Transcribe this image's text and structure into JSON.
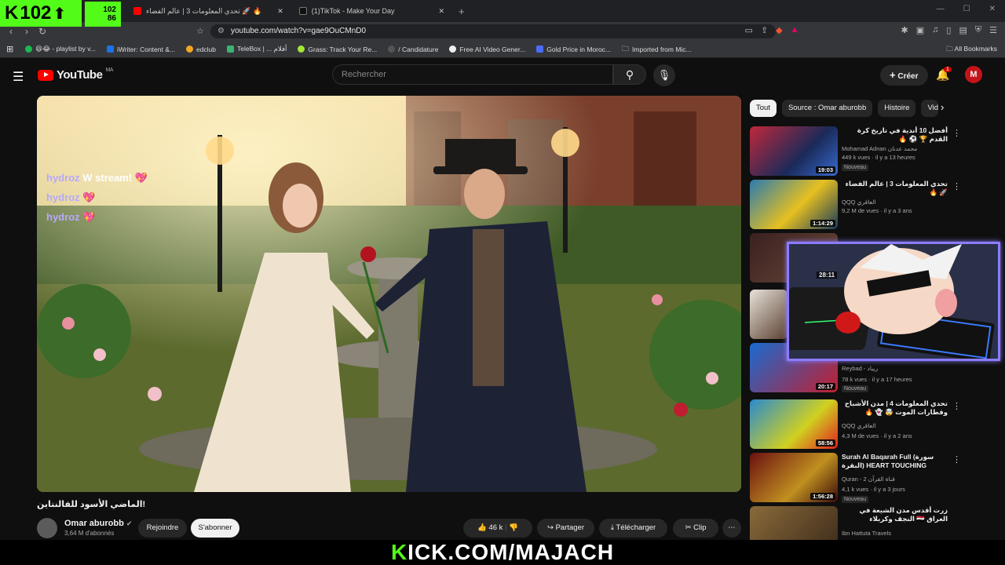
{
  "kick": {
    "viewers": "102",
    "small_top": "102",
    "small_bottom": "86",
    "footer_k": "K",
    "footer_rest": "ICK.COM/MAJACH"
  },
  "browser": {
    "tabs": [
      {
        "title": "تحدي المعلومات 3 | عالم الفضاء 🚀 🔥",
        "active": false
      },
      {
        "title": "(1)TikTok - Make Your Day",
        "active": false
      }
    ],
    "url": "youtube.com/watch?v=gae9OuCMnD0",
    "bookmarks": [
      "😆😂 - playlist by v...",
      "iWriter: Content &...",
      "edclub",
      "TeleBox | ... أفلام",
      "Grass: Track Your Re...",
      "/ Candidature",
      "Free AI Video Gener...",
      "Gold Price in Moroc...",
      "Imported from Mic..."
    ],
    "all_bookmarks": "All Bookmarks"
  },
  "header": {
    "logo": "YouTube",
    "country": "MA",
    "search_placeholder": "Rechercher",
    "create": "Créer",
    "notif_count": "1"
  },
  "chat": [
    {
      "user": "hydroz",
      "msg": "W stream!",
      "heart": "💖"
    },
    {
      "user": "hydroz",
      "msg": "",
      "heart": "💖"
    },
    {
      "user": "hydroz",
      "msg": "",
      "heart": "💖"
    }
  ],
  "video": {
    "title": "الماضي الأسود للفالنتاين!",
    "channel": "Omar aburobb",
    "subs": "3,64 M d'abonnés",
    "join": "Rejoindre",
    "subscribe": "S'abonner",
    "likes": "46 k",
    "share": "Partager",
    "download": "Télécharger",
    "clip": "Clip",
    "more": "⋯"
  },
  "chips": [
    "Tout",
    "Source : Omar aburobb",
    "Histoire",
    "Vid"
  ],
  "recs": [
    {
      "title": "أفضل 10 أندية في تاريخ كرة القدم 🏆 ⚽ 🔥",
      "channel": "Mohamad Adnan محمد عدنان",
      "meta": "449 k vues · il y a 13 heures",
      "badge": "Nouveau",
      "duration": "19:03"
    },
    {
      "title": "تحدي المعلومات 3 | عالم الفضاء 🚀 🔥",
      "channel": "QQQ العاقري",
      "meta": "9,2 M de vues · il y a 3 ans",
      "badge": "",
      "duration": "1:14:29"
    },
    {
      "title": "",
      "channel": "",
      "meta": "",
      "badge": "",
      "duration": "28:11"
    },
    {
      "title": "",
      "channel": "Reybad - ريباد",
      "meta": "78 k vues · il y a 17 heures",
      "badge": "Nouveau",
      "duration": "20:17"
    },
    {
      "title": "تحدي المعلومات 4 | مدن الأشباح وقطارات الموت 🤯 👻 🔥",
      "channel": "QQQ العاقري",
      "meta": "4,3 M de vues · il y a 2 ans",
      "badge": "",
      "duration": "58:56"
    },
    {
      "title": "Surah Al Baqarah Full (سورة البقرة) HEART TOUCHING RECITATIO...",
      "channel": "Quran - 2 قناة القرآن",
      "meta": "4,1 k vues · il y a 3 jours",
      "badge": "Nouveau",
      "duration": "1:56:28"
    },
    {
      "title": "زرت أقدس مدن الشيعة في العراق 🇮🇶 النجف وكربلاء",
      "channel": "Ibn Hattuta Travels",
      "meta": "",
      "badge": "",
      "duration": ""
    }
  ]
}
